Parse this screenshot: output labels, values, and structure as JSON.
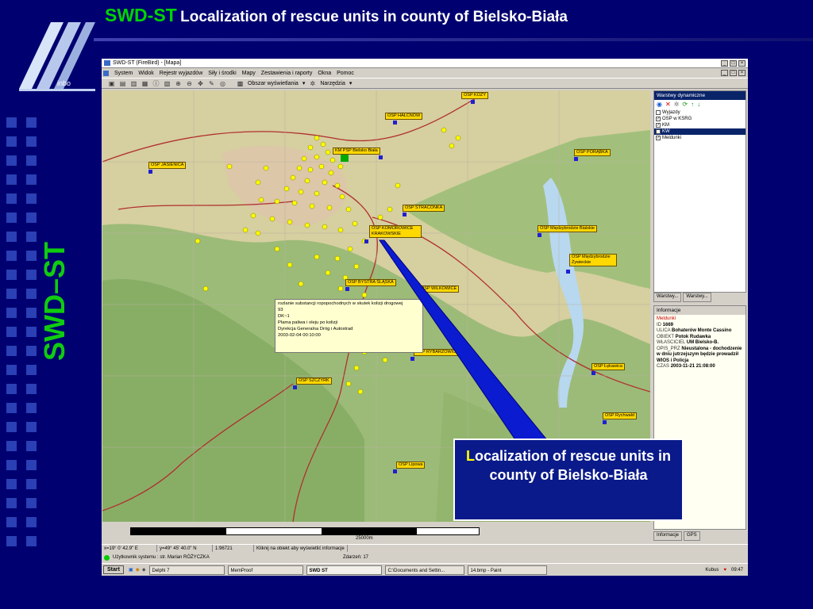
{
  "slide": {
    "title_brand": "SWD-ST",
    "title_text": "Localization of rescue units in county of Bielsko-Biała",
    "vertical_title": "SWD–ST",
    "logo_text": "inbo"
  },
  "app": {
    "window_title": "SWD-ST (FireBird) - [Mapa]",
    "menu": [
      "System",
      "Widok",
      "Rejestr wyjazdów",
      "Siły i środki",
      "Mapy",
      "Zestawienia i raporty",
      "Okna",
      "Pomoc"
    ],
    "toolbar": {
      "area_dropdown": "Obszar wyświetlania",
      "tools_dropdown": "Narzędzia"
    }
  },
  "map": {
    "unit_labels": [
      "OSP KOZY",
      "OSP HAŁCNÓW",
      "KM PSP Bielsko Biała",
      "OSP JASIENICA",
      "OSP PORĄBKA",
      "OSP STRACONKA",
      "OSP KOMOROWICE KRAKOWSKIE",
      "OSP Międzybrodzie Bialskie",
      "OSP Międzybrodzie Żywieckie",
      "OSP BYSTRA ŚLĄSKA",
      "OSP WILKOWICE",
      "OSP RYBARZOWICE",
      "OSP Łękawica",
      "OSP SZCZYRK",
      "OSP Rychwałd",
      "OSP Lipowa"
    ],
    "popup_lines": [
      "rozlanie substancji ropopochodnych w skutek kolizji drogowej",
      "93",
      "DK~1",
      "Plama paliwa i oleju po kolizji",
      "Dyrekcja Generalna Dróg i Autostrad",
      "2003-02-04 00:10:00"
    ],
    "scale_label": "25000m"
  },
  "layers_panel": {
    "title": "Warstwy dynamiczne",
    "items": [
      {
        "label": "Wyjazdy",
        "checked": false
      },
      {
        "label": "OSP w KSRG",
        "checked": true
      },
      {
        "label": "KM",
        "checked": true
      },
      {
        "label": "KW",
        "checked": true
      },
      {
        "label": "Meldunki",
        "checked": true
      }
    ],
    "tabs": [
      "Warstwy...",
      "Warstwy..."
    ]
  },
  "info_panel": {
    "title": "Informacje",
    "heading": "Meldunki",
    "fields": [
      {
        "key": "ID",
        "value": "1669"
      },
      {
        "key": "ULICA",
        "value": "Bohaterów Monte Cassino"
      },
      {
        "key": "OBIEKT",
        "value": "Potok Rudawka"
      },
      {
        "key": "WŁASCICIEL",
        "value": "UM Bielsko-B."
      },
      {
        "key": "OPIS_PRZ",
        "value": "Nieustalona - dochodzenie w dniu jutrzejszym będzie prowadził WIOS i Policja"
      },
      {
        "key": "CZAS",
        "value": "2003-11-21 21:08:00"
      }
    ],
    "tabs": [
      "Informacje",
      "GPS"
    ]
  },
  "status": {
    "x": "x=19° 0' 42.9\" E",
    "y": "y=49° 45' 40.0\" N",
    "scale": "1:96721",
    "hint": "Kliknij na obiekt aby wyświetlić informacje",
    "user": "Użytkownik systemu : str. Marian RÓŻYCZKA",
    "events": "Zdarzeń: 17"
  },
  "taskbar": {
    "start": "Start",
    "tasks": [
      "Delphi 7",
      "MemProof",
      "SWD ST",
      "C:\\Documents and Settin...",
      "14.bmp - Paint"
    ],
    "user": "Kubus",
    "clock": "09:47"
  },
  "callout": {
    "first_letter": "L",
    "text": "ocalization of rescue units in county of Bielsko-Biała"
  },
  "colors": {
    "slide_bg": "#000070",
    "brand_green": "#00d400",
    "label_yellow": "#ffd800",
    "panel_header": "#0a246a"
  }
}
